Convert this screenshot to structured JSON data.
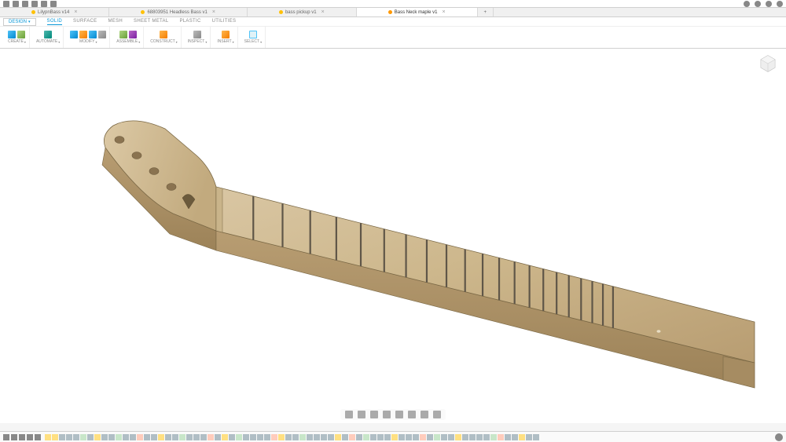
{
  "qat_icons": [
    "grid-icon",
    "file-icon",
    "save-icon",
    "undo-icon",
    "redo-icon",
    "menu-icon"
  ],
  "window_icons": [
    "ext-icon",
    "notif-icon",
    "user-icon",
    "help-icon"
  ],
  "tabs": [
    {
      "label": "LilypnBass v14",
      "active": false,
      "dot": "yellow"
    },
    {
      "label": "68803951 Headless Bass v1",
      "active": false,
      "dot": "yellow"
    },
    {
      "label": "bass pickup v1",
      "active": false,
      "dot": "yellow"
    },
    {
      "label": "Bass Neck maple v1",
      "active": true,
      "dot": "orange"
    }
  ],
  "design_btn": "DESIGN",
  "ribbon_tabs": [
    "SOLID",
    "SURFACE",
    "MESH",
    "SHEET METAL",
    "PLASTIC",
    "UTILITIES"
  ],
  "active_ribbon_tab": 0,
  "groups": [
    {
      "label": "CREATE",
      "icons": [
        "ic-blue",
        "ic-green"
      ]
    },
    {
      "label": "AUTOMATE",
      "icons": [
        "ic-teal"
      ]
    },
    {
      "label": "MODIFY",
      "icons": [
        "ic-blue",
        "ic-orange",
        "ic-blue",
        "ic-gray"
      ]
    },
    {
      "label": "ASSEMBLE",
      "icons": [
        "ic-green",
        "ic-purple"
      ]
    },
    {
      "label": "CONSTRUCT",
      "icons": [
        "ic-orange"
      ]
    },
    {
      "label": "INSPECT",
      "icons": [
        "ic-gray"
      ]
    },
    {
      "label": "INSERT",
      "icons": [
        "ic-orange"
      ]
    },
    {
      "label": "SELECT",
      "icons": [
        "ic-sel"
      ]
    }
  ],
  "nav_icons": [
    "orbit-icon",
    "look-icon",
    "pan-icon",
    "zoom-icon",
    "fit-icon",
    "display-icon",
    "grid-icon",
    "snap-icon"
  ],
  "play_icons": [
    "first-icon",
    "prev-icon",
    "play-icon",
    "next-icon",
    "last-icon"
  ],
  "timeline_items": [
    "s",
    "s",
    "e",
    "e",
    "e",
    "m",
    "e",
    "s",
    "e",
    "e",
    "m",
    "e",
    "e",
    "p",
    "e",
    "e",
    "s",
    "e",
    "e",
    "m",
    "e",
    "e",
    "e",
    "p",
    "e",
    "s",
    "e",
    "m",
    "e",
    "e",
    "e",
    "e",
    "p",
    "s",
    "e",
    "e",
    "m",
    "e",
    "e",
    "e",
    "e",
    "s",
    "e",
    "p",
    "e",
    "m",
    "e",
    "e",
    "e",
    "s",
    "e",
    "e",
    "e",
    "p",
    "e",
    "m",
    "e",
    "e",
    "s",
    "e",
    "e",
    "e",
    "e",
    "m",
    "p",
    "e",
    "e",
    "s",
    "e",
    "e"
  ]
}
